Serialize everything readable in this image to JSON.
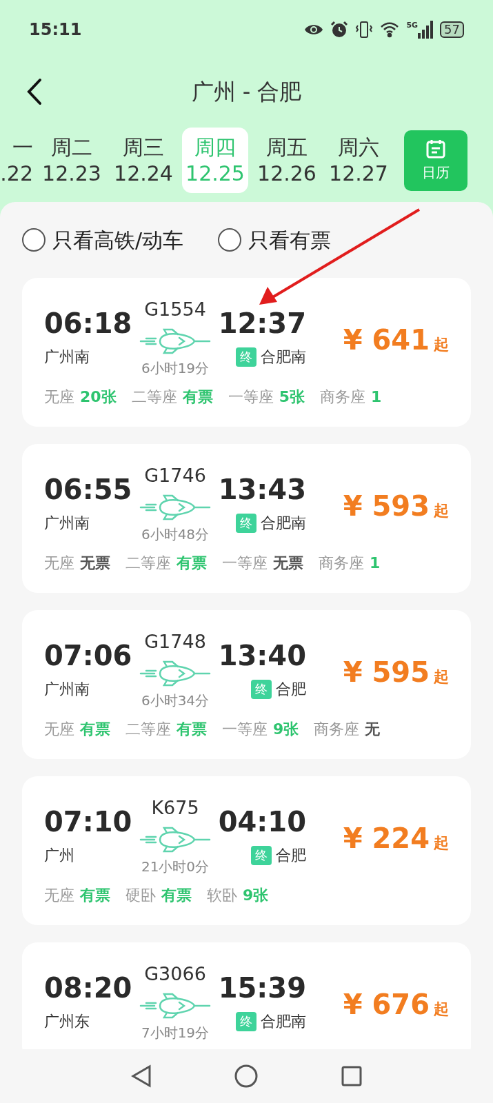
{
  "status_bar": {
    "time": "15:11",
    "network": "5G",
    "battery": "57"
  },
  "header": {
    "title": "广州 - 合肥"
  },
  "dates": [
    {
      "weekday": "一",
      "date": ".22",
      "selected": false,
      "cut": true
    },
    {
      "weekday": "周二",
      "date": "12.23",
      "selected": false,
      "cut": false
    },
    {
      "weekday": "周三",
      "date": "12.24",
      "selected": false,
      "cut": false
    },
    {
      "weekday": "周四",
      "date": "12.25",
      "selected": true,
      "cut": false
    },
    {
      "weekday": "周五",
      "date": "12.26",
      "selected": false,
      "cut": false
    },
    {
      "weekday": "周六",
      "date": "12.27",
      "selected": false,
      "cut": false
    }
  ],
  "calendar_button": "日历",
  "filters": [
    {
      "label": "只看高铁/动车",
      "checked": false
    },
    {
      "label": "只看有票",
      "checked": false
    }
  ],
  "trains": [
    {
      "number": "G1554",
      "depart": "06:18",
      "arrive": "12:37",
      "from": "广州南",
      "to": "合肥南",
      "end_badge": "终",
      "duration": "6小时19分",
      "price_symbol": "¥",
      "price": "641",
      "price_suffix": "起",
      "seats": [
        {
          "name": "无座",
          "value": "20张",
          "available": true
        },
        {
          "name": "二等座",
          "value": "有票",
          "available": true
        },
        {
          "name": "一等座",
          "value": "5张",
          "available": true
        },
        {
          "name": "商务座",
          "value": "1",
          "available": true
        }
      ]
    },
    {
      "number": "G1746",
      "depart": "06:55",
      "arrive": "13:43",
      "from": "广州南",
      "to": "合肥南",
      "end_badge": "终",
      "duration": "6小时48分",
      "price_symbol": "¥",
      "price": "593",
      "price_suffix": "起",
      "seats": [
        {
          "name": "无座",
          "value": "无票",
          "available": false
        },
        {
          "name": "二等座",
          "value": "有票",
          "available": true
        },
        {
          "name": "一等座",
          "value": "无票",
          "available": false
        },
        {
          "name": "商务座",
          "value": "1",
          "available": true
        }
      ]
    },
    {
      "number": "G1748",
      "depart": "07:06",
      "arrive": "13:40",
      "from": "广州南",
      "to": "合肥",
      "end_badge": "终",
      "duration": "6小时34分",
      "price_symbol": "¥",
      "price": "595",
      "price_suffix": "起",
      "seats": [
        {
          "name": "无座",
          "value": "有票",
          "available": true
        },
        {
          "name": "二等座",
          "value": "有票",
          "available": true
        },
        {
          "name": "一等座",
          "value": "9张",
          "available": true
        },
        {
          "name": "商务座",
          "value": "无",
          "available": false
        }
      ]
    },
    {
      "number": "K675",
      "depart": "07:10",
      "arrive": "04:10",
      "from": "广州",
      "to": "合肥",
      "end_badge": "终",
      "duration": "21小时0分",
      "price_symbol": "¥",
      "price": "224",
      "price_suffix": "起",
      "seats": [
        {
          "name": "无座",
          "value": "有票",
          "available": true
        },
        {
          "name": "硬卧",
          "value": "有票",
          "available": true
        },
        {
          "name": "软卧",
          "value": "9张",
          "available": true
        }
      ]
    },
    {
      "number": "G3066",
      "depart": "08:20",
      "arrive": "15:39",
      "from": "广州东",
      "to": "合肥南",
      "end_badge": "终",
      "duration": "7小时19分",
      "price_symbol": "¥",
      "price": "676",
      "price_suffix": "起"
    }
  ]
}
